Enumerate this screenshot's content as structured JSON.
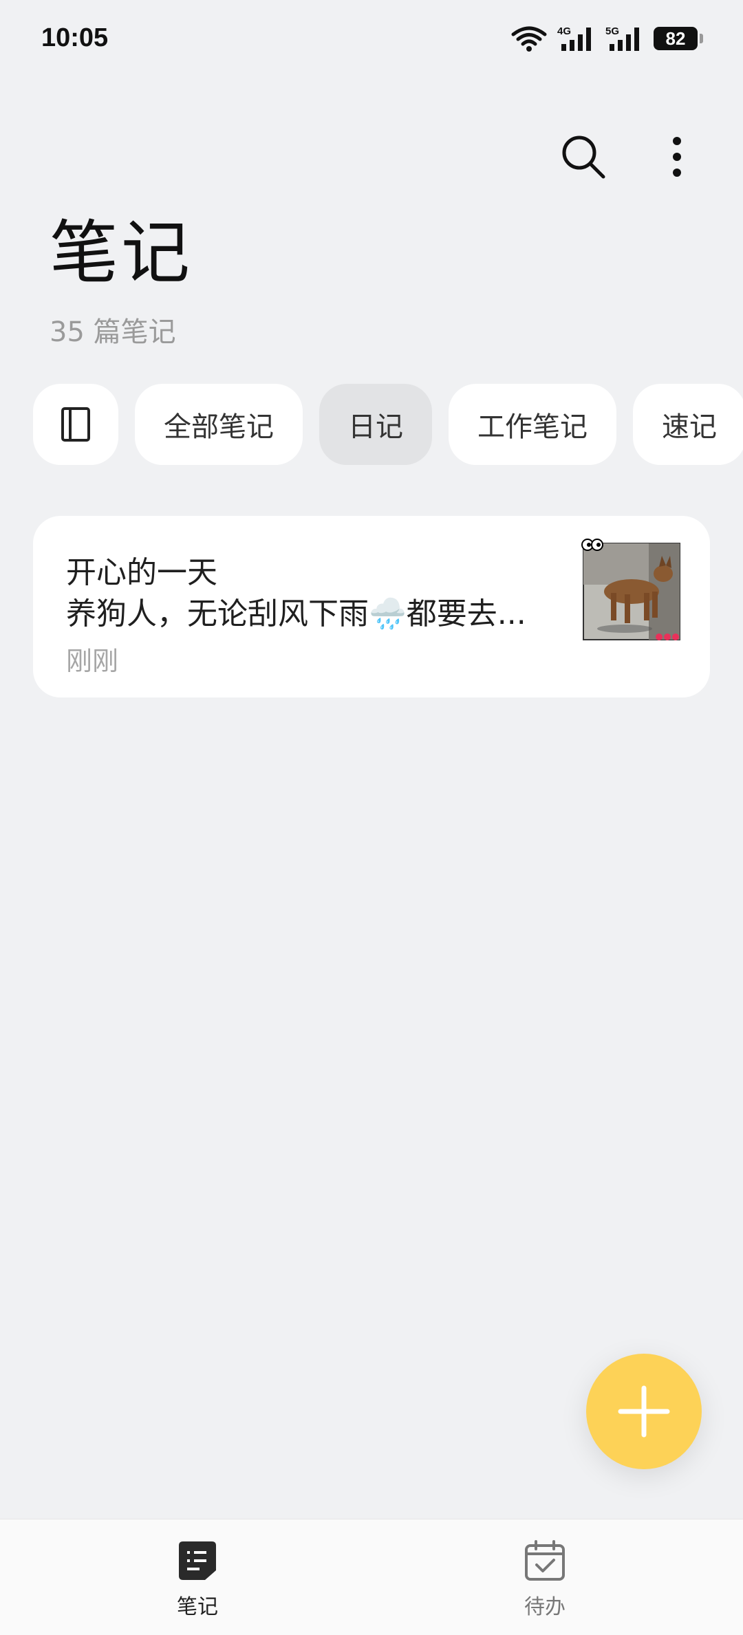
{
  "status_bar": {
    "time": "10:05",
    "battery": "82",
    "network_labels": [
      "4G",
      "5G"
    ]
  },
  "header": {
    "title": "笔记",
    "note_count": "35 篇笔记"
  },
  "chips": [
    {
      "label": "全部笔记",
      "active": false
    },
    {
      "label": "日记",
      "active": true
    },
    {
      "label": "工作笔记",
      "active": false
    },
    {
      "label": "速记",
      "active": false
    }
  ],
  "notes": [
    {
      "title": "开心的一天",
      "preview": "养狗人，无论刮风下雨🌧️都要去...",
      "time": "刚刚"
    }
  ],
  "bottom_nav": {
    "notes_label": "笔记",
    "todo_label": "待办"
  },
  "colors": {
    "background": "#f0f1f3",
    "fab": "#fdd257",
    "active_chip": "#e2e3e5"
  },
  "icons": [
    "search-icon",
    "more-icon",
    "notebook-icon",
    "plus-icon",
    "notes-nav-icon",
    "todo-nav-icon"
  ]
}
